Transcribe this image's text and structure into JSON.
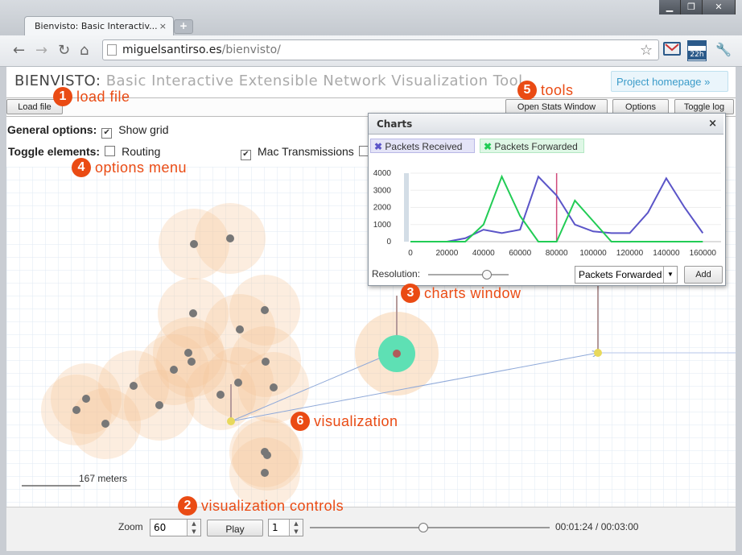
{
  "browser": {
    "tab_title": "Bienvisto: Basic Interactiv...",
    "tab_close": "×",
    "new_tab": "+",
    "url_host": "miguelsantirso.es",
    "url_path": "/bienvisto/",
    "window_buttons": [
      "▁",
      "❐",
      "✕"
    ],
    "nav_icons": [
      "back-icon",
      "forward-icon",
      "reload-icon",
      "home-icon"
    ],
    "toolbar_icons": [
      "star-icon",
      "gmail-icon",
      "calendar-icon",
      "wrench-icon"
    ],
    "calendar_badge": "22h"
  },
  "app": {
    "title": "BIENVISTO:",
    "subtitle": "Basic Interactive Extensible Network Visualization Tool",
    "homepage_label": "Project homepage »",
    "load_file_label": "Load file",
    "tools": [
      "Open Stats Window",
      "Options",
      "Toggle log"
    ]
  },
  "options": {
    "general_label": "General options:",
    "show_grid_label": "Show grid",
    "show_grid_checked": true,
    "toggle_label": "Toggle elements:",
    "routing_label": "Routing",
    "routing_checked": false,
    "mac_label": "Mac Transmissions",
    "mac_checked": true
  },
  "charts_window": {
    "title": "Charts",
    "close": "×",
    "legend": [
      {
        "label": "Packets Received",
        "color": "#5b55c8",
        "bg": "#e4e4f7",
        "x": "✖"
      },
      {
        "label": "Packets Forwarded",
        "color": "#22cc55",
        "bg": "#dff7e6",
        "x": "✖"
      }
    ],
    "resolution_label": "Resolution:",
    "resolution_value": 0.72,
    "select_value": "Packets Forwarded",
    "add_label": "Add"
  },
  "chart_data": {
    "type": "line",
    "x": [
      0,
      20000,
      30000,
      40000,
      50000,
      60000,
      70000,
      80000,
      90000,
      100000,
      110000,
      120000,
      130000,
      140000,
      150000,
      160000
    ],
    "series": [
      {
        "name": "Packets Received",
        "color": "#5b55c8",
        "values": [
          0,
          0,
          200,
          700,
          500,
          700,
          3800,
          2700,
          1000,
          600,
          500,
          500,
          1700,
          3700,
          2000,
          500
        ]
      },
      {
        "name": "Packets Forwarded",
        "color": "#22cc55",
        "values": [
          0,
          0,
          0,
          1000,
          3800,
          1500,
          0,
          0,
          2400,
          1200,
          0,
          0,
          0,
          0,
          0,
          0
        ]
      }
    ],
    "cursor_x": 80000,
    "ylim": [
      0,
      4000
    ],
    "xlim": [
      0,
      170000
    ],
    "yticks": [
      0,
      1000,
      2000,
      3000,
      4000
    ],
    "xticks": [
      0,
      20000,
      40000,
      60000,
      80000,
      100000,
      120000,
      140000,
      160000
    ],
    "grid": true
  },
  "viz": {
    "scale_label": "167 meters"
  },
  "controls": {
    "zoom_label": "Zoom",
    "zoom_value": "60",
    "play_label": "Play",
    "speed_value": "1",
    "time_position": 0.47,
    "time_label": "00:01:24 / 00:03:00"
  },
  "callouts": [
    {
      "num": "1",
      "text": "load file"
    },
    {
      "num": "2",
      "text": "visualization controls"
    },
    {
      "num": "3",
      "text": "charts window"
    },
    {
      "num": "4",
      "text": "options menu"
    },
    {
      "num": "5",
      "text": "tools"
    },
    {
      "num": "6",
      "text": "visualization"
    }
  ]
}
